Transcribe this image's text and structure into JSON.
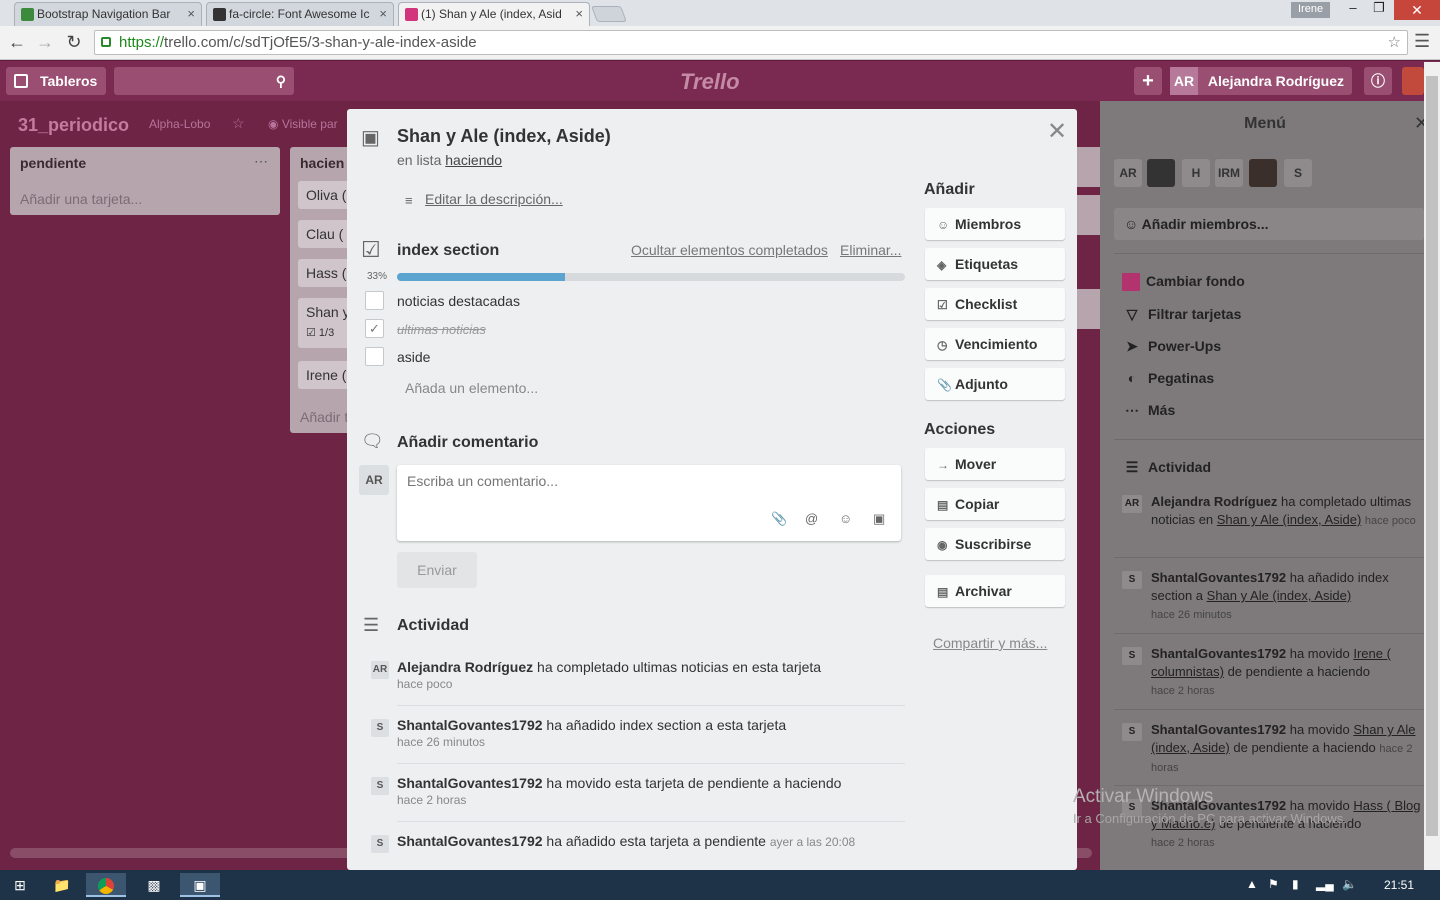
{
  "browser": {
    "tabs": [
      {
        "title": "Bootstrap Navigation Bar",
        "fav_color": "#3c8a3c"
      },
      {
        "title": "fa-circle: Font Awesome Ic",
        "fav_color": "#333333"
      },
      {
        "title": "(1) Shan y Ale (index, Asid",
        "fav_color": "#d2357b"
      }
    ],
    "tab_close": "×",
    "window_user": "Irene",
    "url_scheme": "https://",
    "url_rest": "trello.com/c/sdTjOfE5/3-shan-y-ale-index-aside",
    "min": "–",
    "max": "❐",
    "close": "✕"
  },
  "header": {
    "boards_label": "Tableros",
    "logo": "Trello",
    "user_initials": "AR",
    "user_name": "Alejandra Rodríguez"
  },
  "board": {
    "name": "31_periodico",
    "team": "Alpha-Lobo",
    "visibility": "Visible par",
    "lists": [
      {
        "title": "pendiente",
        "add": "Añadir una tarjeta..."
      },
      {
        "title": "hacien",
        "add": "Añadir t"
      }
    ],
    "cards": [
      "Oliva (",
      "Clau (",
      "Hass (",
      "Shan y",
      "Irene ("
    ],
    "card_badge": "1/3"
  },
  "side_menu": {
    "title": "Menú",
    "members": [
      "AR",
      "",
      "H",
      "IRM",
      "",
      "S"
    ],
    "add_members": "Añadir miembros...",
    "items": [
      "Cambiar fondo",
      "Filtrar tarjetas",
      "Power-Ups",
      "Pegatinas",
      "Más"
    ],
    "activity_title": "Actividad",
    "activity": [
      {
        "av": "AR",
        "user": "Alejandra Rodríguez",
        "text": " ha completado ultimas noticias en ",
        "link": "Shan y Ale (index, Aside)",
        "time": "hace poco"
      },
      {
        "av": "S",
        "user": "ShantalGovantes1792",
        "text": " ha añadido index section a ",
        "link": "Shan y Ale (index, Aside)",
        "time": "hace 26 minutos"
      },
      {
        "av": "S",
        "user": "ShantalGovantes1792",
        "text": " ha movido ",
        "link": "Irene ( columnistas)",
        "text2": " de pendiente a haciendo",
        "time": "hace 2 horas"
      },
      {
        "av": "S",
        "user": "ShantalGovantes1792",
        "text": " ha movido ",
        "link": "Shan y Ale (index, Aside)",
        "text2": " de pendiente a haciendo",
        "time": "hace 2 horas"
      },
      {
        "av": "S",
        "user": "ShantalGovantes1792",
        "text": " ha movido ",
        "link": "Hass ( Blog y Macho.e)",
        "text2": " de pendiente a haciendo",
        "time": "hace 2 horas"
      }
    ]
  },
  "card_modal": {
    "title": "Shan y Ale (index, Aside)",
    "in_list_prefix": "en lista ",
    "in_list": "haciendo",
    "edit_description": "Editar la descripción...",
    "checklist": {
      "title": "index section",
      "hide_completed": "Ocultar elementos completados",
      "delete": "Eliminar...",
      "percent_label": "33%",
      "progress": 0.33,
      "items": [
        {
          "text": "noticias destacadas",
          "done": false
        },
        {
          "text": "ultimas noticias",
          "done": true
        },
        {
          "text": "aside",
          "done": false
        }
      ],
      "add_item": "Añada un elemento..."
    },
    "comment": {
      "title": "Añadir comentario",
      "avatar": "AR",
      "placeholder": "Escriba un comentario...",
      "send": "Enviar"
    },
    "activity": {
      "title": "Actividad",
      "entries": [
        {
          "av": "AR",
          "user": "Alejandra Rodríguez",
          "text": " ha completado ultimas noticias en esta tarjeta",
          "time": "hace poco"
        },
        {
          "av": "S",
          "user": "ShantalGovantes1792",
          "text": " ha añadido index section a esta tarjeta",
          "time": "hace 26 minutos"
        },
        {
          "av": "S",
          "user": "ShantalGovantes1792",
          "text": " ha movido esta tarjeta de pendiente a haciendo",
          "time": "hace 2 horas"
        },
        {
          "av": "S",
          "user": "ShantalGovantes1792",
          "text": " ha añadido esta tarjeta a pendiente",
          "time": "ayer a las 20:08"
        }
      ]
    },
    "add_title": "Añadir",
    "add_buttons": [
      {
        "label": "Miembros",
        "icon": "person-icon"
      },
      {
        "label": "Etiquetas",
        "icon": "tag-icon"
      },
      {
        "label": "Checklist",
        "icon": "checkbox-icon"
      },
      {
        "label": "Vencimiento",
        "icon": "clock-icon"
      },
      {
        "label": "Adjunto",
        "icon": "paperclip-icon"
      }
    ],
    "actions_title": "Acciones",
    "action_buttons": [
      {
        "label": "Mover",
        "icon": "arrow-icon"
      },
      {
        "label": "Copiar",
        "icon": "copy-icon"
      },
      {
        "label": "Suscribirse",
        "icon": "eye-icon"
      },
      {
        "label": "Archivar",
        "icon": "archive-icon"
      }
    ],
    "share": "Compartir y más..."
  },
  "watermark": {
    "line1": "Activar Windows",
    "line2": "Ir a Configuración de PC para activar Windows."
  },
  "taskbar": {
    "clock": "21:51"
  }
}
